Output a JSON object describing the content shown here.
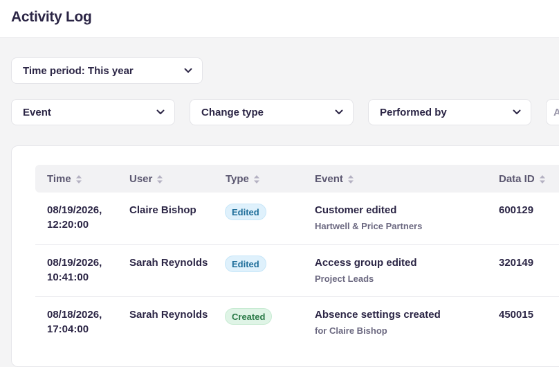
{
  "header": {
    "title": "Activity Log"
  },
  "filters": {
    "time_period": "Time period: This year",
    "event": "Event",
    "change_type": "Change type",
    "performed_by": "Performed by",
    "partial_next": "A"
  },
  "table": {
    "columns": [
      "Time",
      "User",
      "Type",
      "Event",
      "Data ID"
    ],
    "rows": [
      {
        "date": "08/19/2026,",
        "time": "12:20:00",
        "user": "Claire Bishop",
        "type": "Edited",
        "event": "Customer edited",
        "event_detail": "Hartwell & Price Partners",
        "data_id": "600129"
      },
      {
        "date": "08/19/2026,",
        "time": "10:41:00",
        "user": "Sarah Reynolds",
        "type": "Edited",
        "event": "Access group edited",
        "event_detail": "Project Leads",
        "data_id": "320149"
      },
      {
        "date": "08/18/2026,",
        "time": "17:04:00",
        "user": "Sarah Reynolds",
        "type": "Created",
        "event": "Absence settings created",
        "event_detail": "for Claire Bishop",
        "data_id": "450015"
      }
    ]
  },
  "colors": {
    "text": "#2b2545",
    "edited_badge_bg": "#dff1fc",
    "created_badge_bg": "#dff4e6"
  }
}
